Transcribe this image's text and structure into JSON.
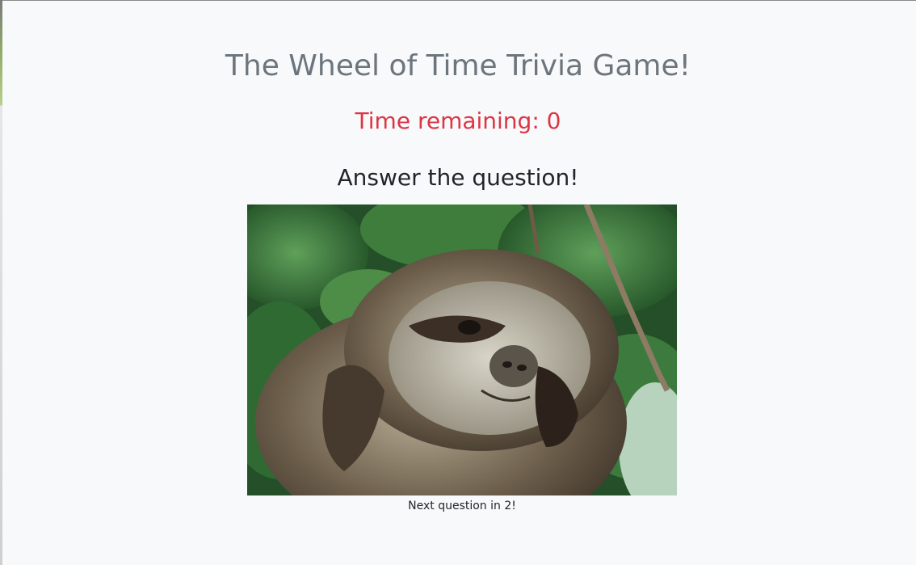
{
  "game": {
    "title": "The Wheel of Time Trivia Game!",
    "timer_text": "Time remaining: 0",
    "prompt": "Answer the question!",
    "next_question_text": "Next question in 2!"
  },
  "media": {
    "image_icon": "sloth-gif-image"
  },
  "colors": {
    "background": "#f8f9fa",
    "title": "#6c757d",
    "timer": "#dc3545",
    "prompt": "#212529"
  }
}
